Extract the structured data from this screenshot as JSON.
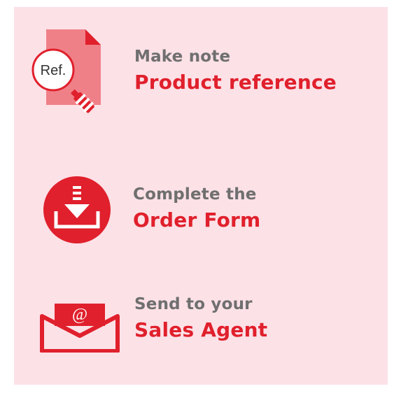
{
  "steps": [
    {
      "icon": "document-magnifier-icon",
      "icon_label": "Ref.",
      "line1": "Make note",
      "line2": "Product reference"
    },
    {
      "icon": "download-circle-icon",
      "line1": "Complete the",
      "line2": "Order Form"
    },
    {
      "icon": "envelope-at-icon",
      "icon_label": "@",
      "line1": "Send to your",
      "line2": "Sales Agent"
    }
  ],
  "colors": {
    "background": "#fce1e7",
    "accent": "#e0202c",
    "gray_text": "#6f6f6f"
  }
}
